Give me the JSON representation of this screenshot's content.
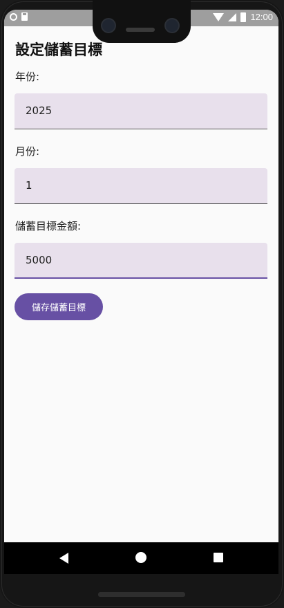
{
  "status_bar": {
    "time": "12:00"
  },
  "screen": {
    "title": "設定儲蓄目標",
    "fields": [
      {
        "label": "年份:",
        "value": "2025"
      },
      {
        "label": "月份:",
        "value": "1"
      },
      {
        "label": "儲蓄目標金額:",
        "value": "5000"
      }
    ],
    "save_button": "儲存儲蓄目標"
  },
  "colors": {
    "accent": "#6750a4",
    "field_bg": "#e8e0ec",
    "screen_bg": "#fafafa"
  }
}
